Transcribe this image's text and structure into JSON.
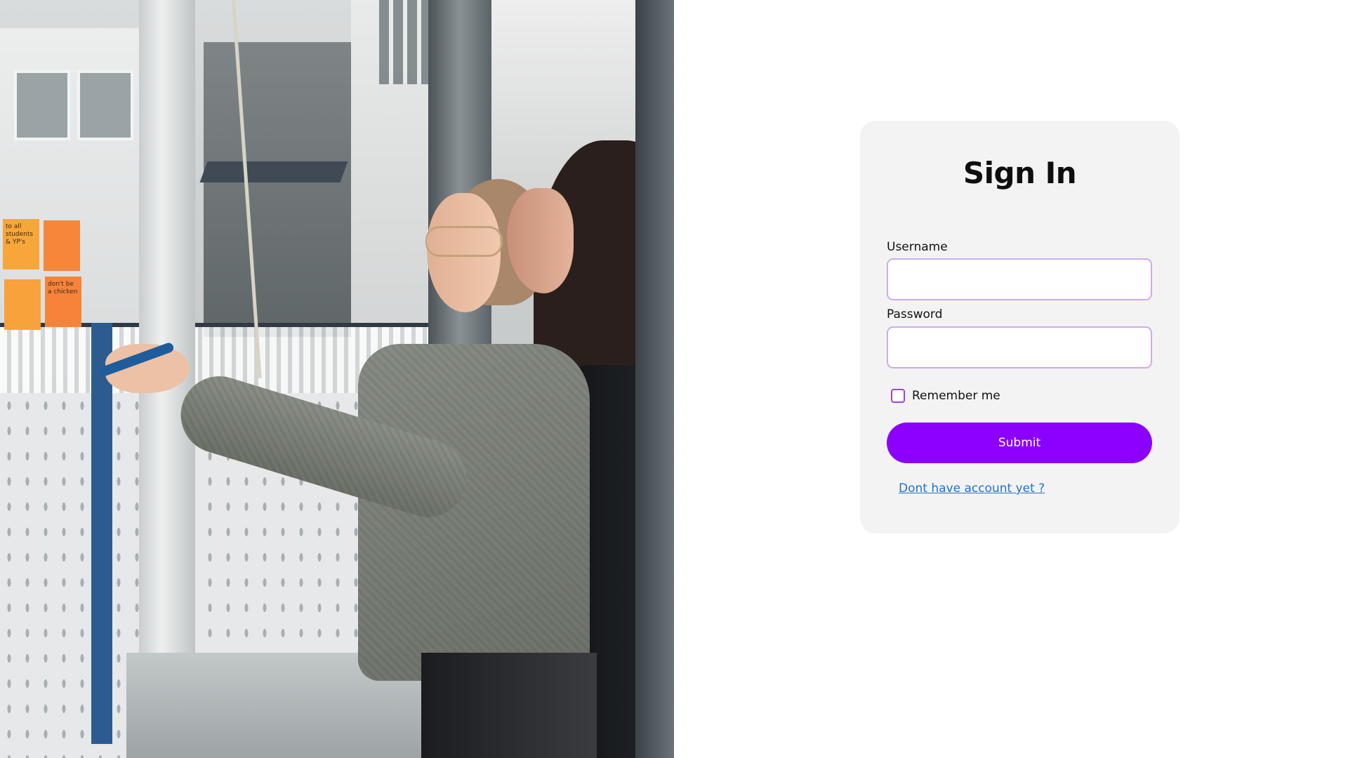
{
  "login": {
    "title": "Sign In",
    "username_label": "Username",
    "username_value": "",
    "password_label": "Password",
    "password_value": "",
    "remember_label": "Remember me",
    "remember_checked": false,
    "submit_label": "Submit",
    "signup_link": "Dont have account yet ?"
  },
  "photo": {
    "sticky_notes": [
      "to all students & YP's",
      "",
      "",
      "don't be a chicken"
    ]
  },
  "colors": {
    "accent": "#8b00ff",
    "input_border": "#d3a8ee",
    "card_background": "#f3f3f3",
    "link": "#1f73c9"
  }
}
